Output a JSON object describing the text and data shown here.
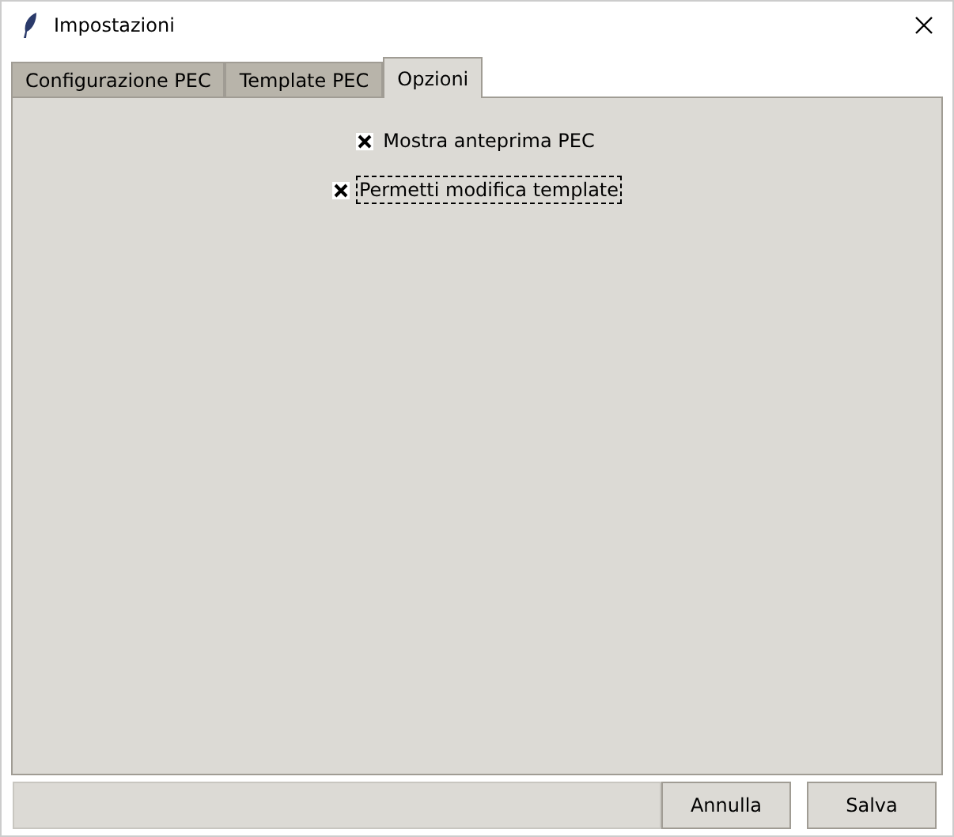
{
  "window": {
    "title": "Impostazioni"
  },
  "tabs": [
    {
      "label": "Configurazione PEC",
      "selected": false
    },
    {
      "label": "Template PEC",
      "selected": false
    },
    {
      "label": "Opzioni",
      "selected": true
    }
  ],
  "options": [
    {
      "label": "Mostra anteprima PEC",
      "checked": true,
      "focused": false
    },
    {
      "label": "Permetti modifica template",
      "checked": true,
      "focused": true
    }
  ],
  "buttons": [
    "Annulla",
    "Salva"
  ]
}
